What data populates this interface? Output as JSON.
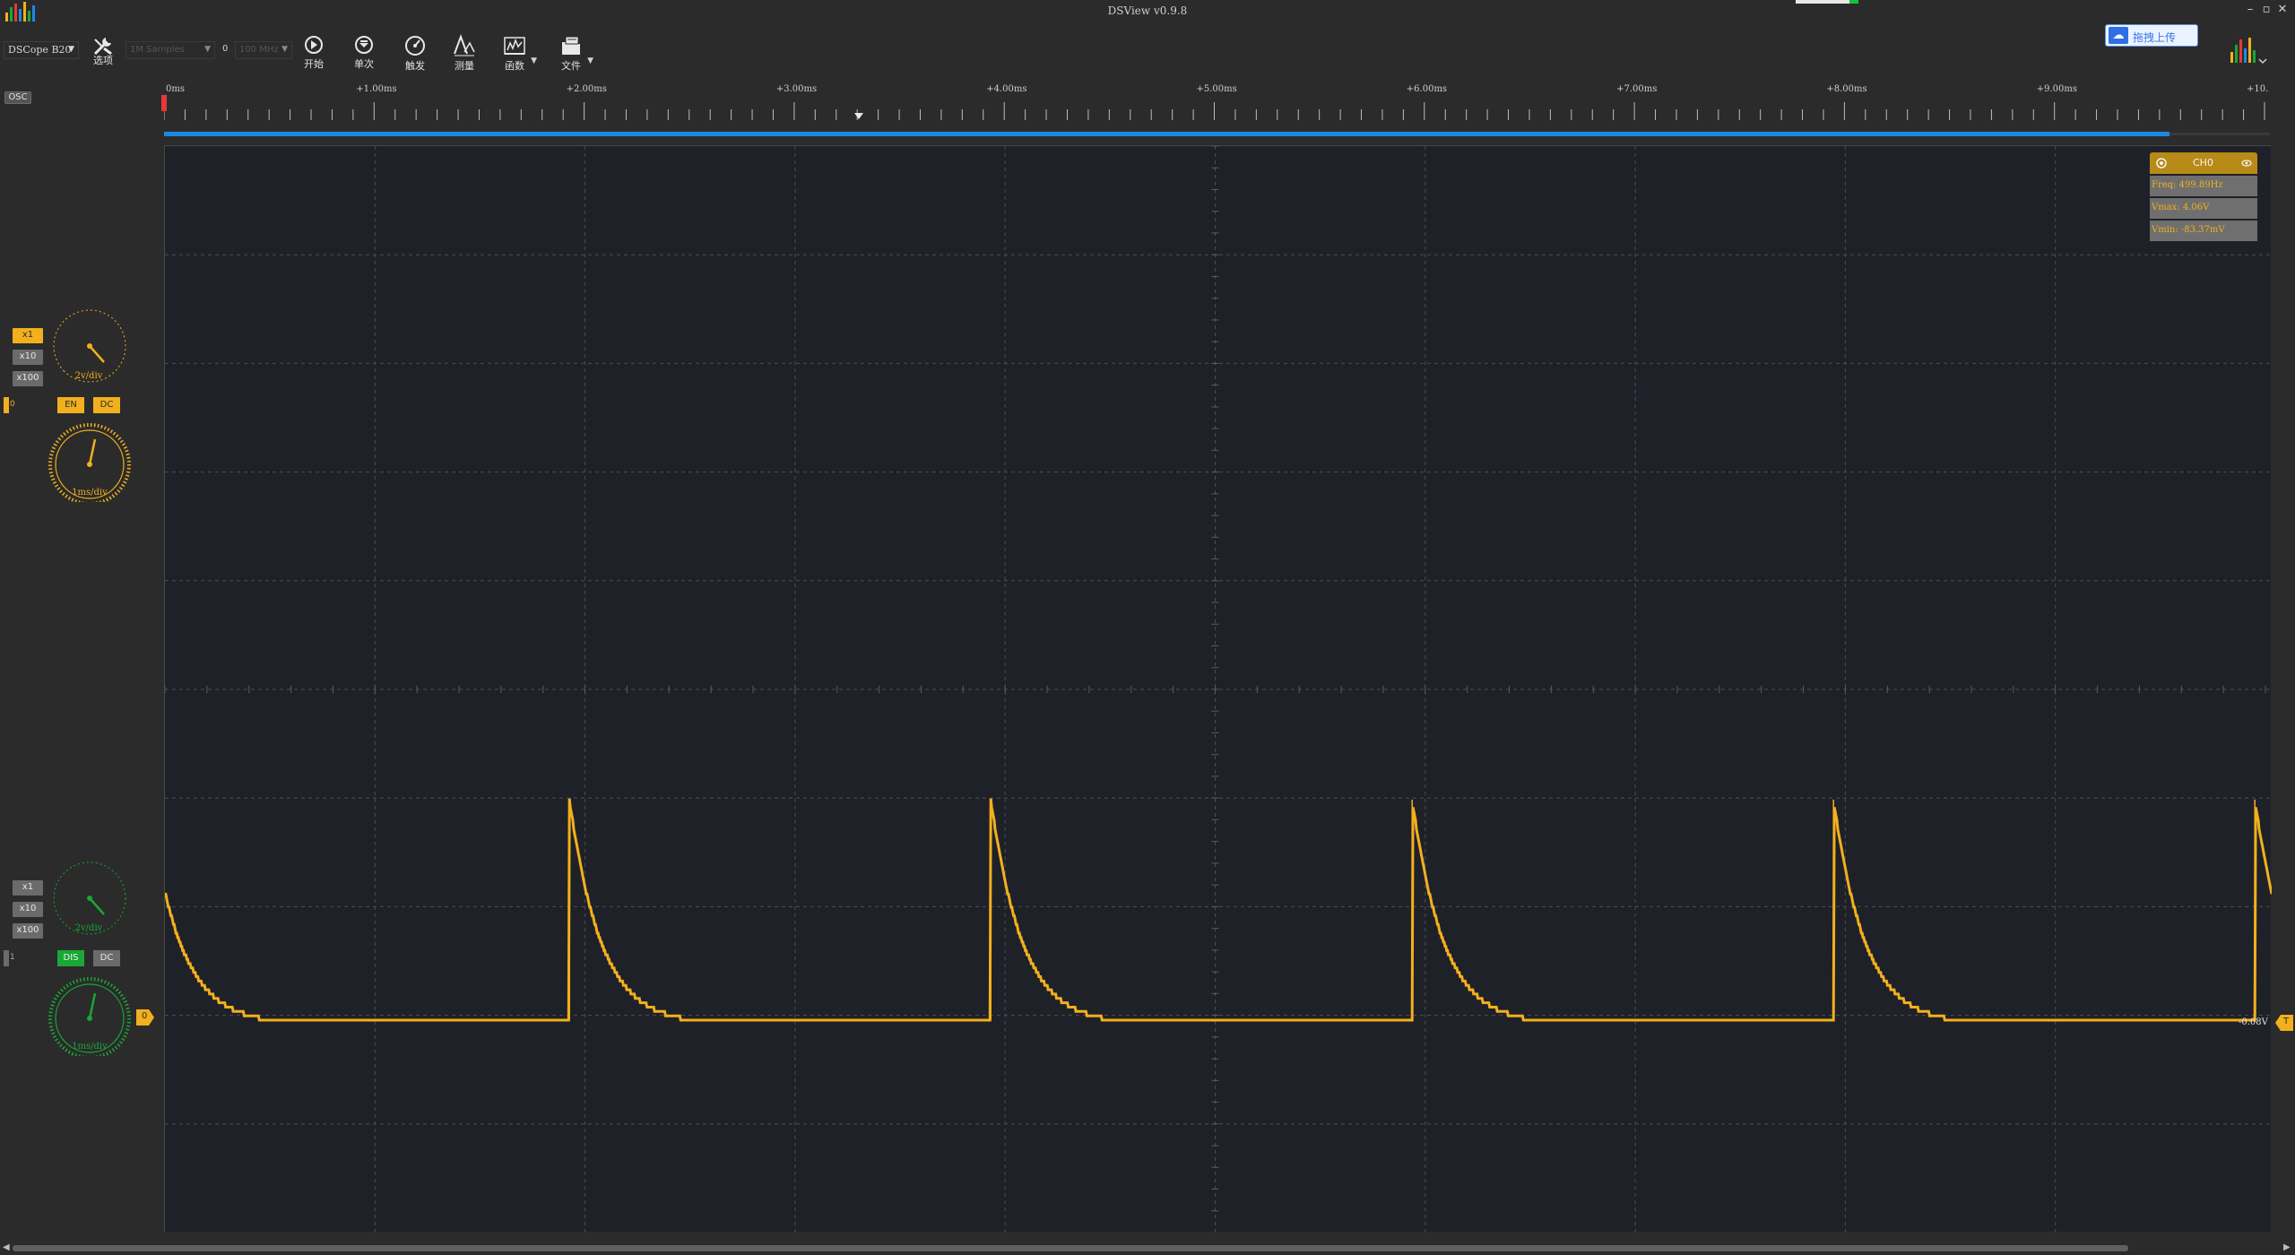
{
  "window": {
    "title": "DSView v0.9.8"
  },
  "cloud": {
    "label": "拖拽上传",
    "icon": "cloud-upload-icon"
  },
  "toolbar": {
    "device": "DSCope B20",
    "samples": "1M Samples",
    "zero": "0",
    "rate": "100 MHz",
    "options_label": "选项",
    "start_label": "开始",
    "single_label": "单次",
    "trigger_label": "触发",
    "measure_label": "测量",
    "math_label": "函数",
    "file_label": "文件"
  },
  "mode_tab": "OSC",
  "ch0": {
    "probe_x1": "x1",
    "probe_x10": "x10",
    "probe_x100": "x100",
    "volt_div": "2v/div",
    "en": "EN",
    "coupling": "DC",
    "time_div": "1ms/div",
    "color": "#f2b01e",
    "index": "0"
  },
  "ch1": {
    "probe_x1": "x1",
    "probe_x10": "x10",
    "probe_x100": "x100",
    "volt_div": "2v/div",
    "en": "DIS",
    "coupling": "DC",
    "time_div": "1ms/div",
    "color": "#18a834",
    "index": "1"
  },
  "ruler": {
    "labels": [
      "0ms",
      "+1.00ms",
      "+2.00ms",
      "+3.00ms",
      "+4.00ms",
      "+5.00ms",
      "+6.00ms",
      "+7.00ms",
      "+8.00ms",
      "+9.00ms",
      "+10."
    ]
  },
  "measure": {
    "channel": "CH0",
    "freq": "Freq: 499.89Hz",
    "vmax": "Vmax: 4.06V",
    "vmin": "Vmin: -83.37mV"
  },
  "markers": {
    "ch0_offset": "0",
    "trigger": "T",
    "right_value": "-0.08V"
  },
  "chart_data": {
    "type": "line",
    "xlabel": "",
    "ylabel": "",
    "xlim": [
      0,
      10.0
    ],
    "x_unit": "ms",
    "series": [
      {
        "color": "#f2b01e",
        "period_ms": 2.0,
        "first_edge_ms": 1.92,
        "vmax": 4.06,
        "vmin": -0.0834,
        "decay_tau_ms": 0.15
      }
    ]
  }
}
